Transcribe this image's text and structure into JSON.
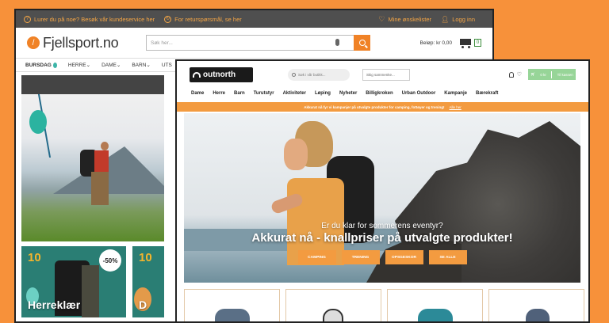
{
  "fjellsport": {
    "topbar": {
      "help_text": "Lurer du på noe? Besøk vår kundeservice her",
      "returns_text": "For returspørsmål, se her",
      "wishlist_label": "Mine ønskelister",
      "login_label": "Logg inn"
    },
    "header": {
      "logo_text": "Fjellsport.no",
      "search_placeholder": "Søk her...",
      "balance_label": "Beløp:  kr 0,00",
      "cart_count": "0"
    },
    "nav": {
      "items": [
        "BURSDAG",
        "HERRE",
        "DAME",
        "BARN",
        "UTS"
      ]
    },
    "tiles": {
      "tile1": {
        "badge_number": "10",
        "discount": "-50%",
        "label": "Herreklær"
      },
      "tile2": {
        "badge_number": "10",
        "label": "D"
      }
    }
  },
  "outnorth": {
    "header": {
      "logo_text": "outnorth",
      "search_placeholder": "Søk i vår butikk...",
      "news_placeholder": "Skig sammenke...",
      "cart_left": "0 kr",
      "cart_right": "Til kassen"
    },
    "nav": [
      "Dame",
      "Herre",
      "Barn",
      "Turutstyr",
      "Aktiviteter",
      "Løping",
      "Nyheter",
      "Billigkroken",
      "Urban Outdoor",
      "Kampanje",
      "Bærekraft"
    ],
    "banner": {
      "text": "Akkurat nå fyr vi kampanjer på utvalgte produkter for camping, fottøyer og trening!",
      "link": "Alle her"
    },
    "hero": {
      "subtitle": "Er du klar for sommerens eventyr?",
      "title": "Akkurat nå - knallpriser på utvalgte produkter!",
      "buttons": [
        "CAMPING",
        "TRENING",
        "OPSGESKOR",
        "SE ALLE"
      ]
    }
  },
  "colors": {
    "background": "#f7913a",
    "accent_orange": "#f08226",
    "topbar_gray": "#4f4f4f",
    "cart_green": "#97d598"
  }
}
